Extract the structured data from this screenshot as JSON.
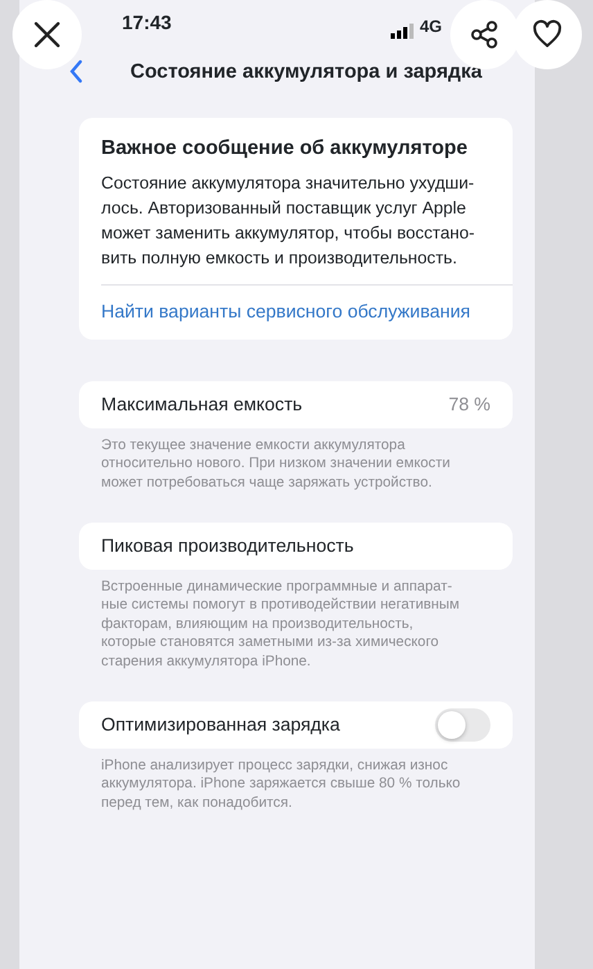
{
  "overlay_buttons": [
    {
      "kind": "close"
    },
    {
      "kind": "share"
    },
    {
      "kind": "favorite"
    }
  ],
  "status_bar": {
    "time": "17:43",
    "network": "4G"
  },
  "nav": {
    "title": "Состояние аккумулятора и зарядка"
  },
  "sections": [
    {
      "kind": "message",
      "title": "Важное сообщение об аккумуляторе",
      "text": "Состояние аккумулятора значительно ухудши-\nлось. Авторизованный поставщик услуг Apple\nможет заменить аккумулятор, чтобы восстано-\nвить полную емкость и производительность.",
      "link": "Найти варианты сервисного обслуживания"
    },
    {
      "kind": "value",
      "label": "Максимальная емкость",
      "value": "78 %",
      "footnote": "Это текущее значение емкости аккумулятора\nотносительно нового. При низком значении емкости\nможет потребоваться чаще заряжать устройство."
    },
    {
      "kind": "plain",
      "label": "Пиковая производительность",
      "footnote": "Встроенные динамические программные и аппарат-\nные системы помогут в противодействии негативным\nфакторам, влияющим на производительность,\nкоторые становятся заметными из-за химического\nстарения аккумулятора iPhone."
    },
    {
      "kind": "toggle",
      "label": "Оптимизированная зарядка",
      "on": false,
      "footnote": "iPhone анализирует процесс зарядки, снижая износ\nаккумулятора. iPhone заряжается свыше 80 % только\nперед тем, как понадобится."
    }
  ]
}
